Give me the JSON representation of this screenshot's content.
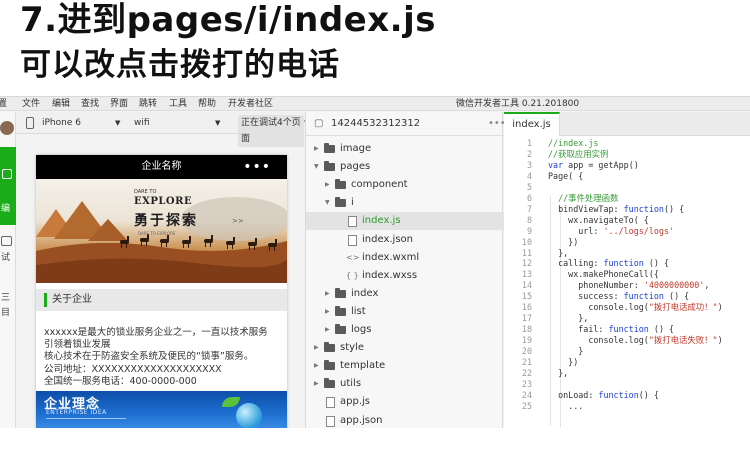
{
  "heading": {
    "line1": "7.进到pages/i/index.js",
    "line2": "可以改点击拨打的电话"
  },
  "menubar": {
    "items": [
      "置",
      "文件",
      "编辑",
      "查找",
      "界面",
      "跳转",
      "工具",
      "帮助",
      "开发者社区"
    ],
    "title": "微信开发者工具 0.21.201800"
  },
  "leftstrip": {
    "active_label": "编",
    "labels": [
      "试",
      "三",
      "目"
    ]
  },
  "device_toolbar": {
    "device": "iPhone 6",
    "network": "wifi",
    "debug_status": "正在调试4个页面"
  },
  "simulator": {
    "nav_title": "企业名称",
    "nav_menu": "•••",
    "banner": {
      "small_text": "DARE TO",
      "big_text": "EXPLORE",
      "cn_text": "勇于探索",
      "arrow": ">>",
      "sub_text": "DARE TO EXPLORE"
    },
    "about_label": "关于企业",
    "about_lines": [
      "xxxxxx是最大的锁业服务企业之一，一直以技术服务",
      "引领着锁业发展",
      "核心技术在于防盗安全系统及便民的“锁事”服务。",
      "公司地址：XXXXXXXXXXXXXXXXXXXX",
      "全国统一服务电话：400-0000-000"
    ],
    "idea_title": "企业理念",
    "idea_subtitle": "ENTERPRISE IDEA"
  },
  "filetree": {
    "project": "14244532312312",
    "more": "•••",
    "rows": [
      {
        "label": "image",
        "type": "folder",
        "open": false,
        "depth": 0
      },
      {
        "label": "pages",
        "type": "folder",
        "open": true,
        "depth": 0
      },
      {
        "label": "component",
        "type": "folder",
        "open": false,
        "depth": 1
      },
      {
        "label": "i",
        "type": "folder",
        "open": true,
        "depth": 1
      },
      {
        "label": "index.js",
        "type": "js",
        "depth": 2,
        "selected": true
      },
      {
        "label": "index.json",
        "type": "json",
        "depth": 2
      },
      {
        "label": "index.wxml",
        "type": "wxml",
        "depth": 2
      },
      {
        "label": "index.wxss",
        "type": "wxss",
        "depth": 2
      },
      {
        "label": "index",
        "type": "folder",
        "open": false,
        "depth": 1
      },
      {
        "label": "list",
        "type": "folder",
        "open": false,
        "depth": 1
      },
      {
        "label": "logs",
        "type": "folder",
        "open": false,
        "depth": 1
      },
      {
        "label": "style",
        "type": "folder",
        "open": false,
        "depth": 0
      },
      {
        "label": "template",
        "type": "folder",
        "open": false,
        "depth": 0
      },
      {
        "label": "utils",
        "type": "folder",
        "open": false,
        "depth": 0
      },
      {
        "label": "app.js",
        "type": "js",
        "depth": 0
      },
      {
        "label": "app.json",
        "type": "json",
        "depth": 0
      }
    ]
  },
  "editor": {
    "tab": "index.js",
    "lines": [
      [
        {
          "t": "//index.js",
          "c": "com"
        }
      ],
      [
        {
          "t": "//获取应用实例",
          "c": "com"
        }
      ],
      [
        {
          "t": "var",
          "c": "kw"
        },
        {
          "t": " app = getApp()"
        }
      ],
      [
        {
          "t": "Page( {"
        }
      ],
      [
        {
          "t": ""
        }
      ],
      [
        {
          "t": "  //事件处理函数",
          "c": "com"
        }
      ],
      [
        {
          "t": "  bindViewTap: "
        },
        {
          "t": "function",
          "c": "kw"
        },
        {
          "t": "() {"
        }
      ],
      [
        {
          "t": "    wx.navigateTo( {"
        }
      ],
      [
        {
          "t": "      url: "
        },
        {
          "t": "'../logs/logs'",
          "c": "str"
        }
      ],
      [
        {
          "t": "    })"
        }
      ],
      [
        {
          "t": "  },"
        }
      ],
      [
        {
          "t": "  calling: "
        },
        {
          "t": "function",
          "c": "kw"
        },
        {
          "t": " () {"
        }
      ],
      [
        {
          "t": "    wx.makePhoneCall({"
        }
      ],
      [
        {
          "t": "      phoneNumber: "
        },
        {
          "t": "'4000000000'",
          "c": "str"
        },
        {
          "t": ","
        }
      ],
      [
        {
          "t": "      success: "
        },
        {
          "t": "function",
          "c": "kw"
        },
        {
          "t": " () {"
        }
      ],
      [
        {
          "t": "        console.log("
        },
        {
          "t": "\"拨打电话成功！\"",
          "c": "str"
        },
        {
          "t": ")"
        }
      ],
      [
        {
          "t": "      },"
        }
      ],
      [
        {
          "t": "      fail: "
        },
        {
          "t": "function",
          "c": "kw"
        },
        {
          "t": " () {"
        }
      ],
      [
        {
          "t": "        console.log("
        },
        {
          "t": "\"拨打电话失败！\"",
          "c": "str"
        },
        {
          "t": ")"
        }
      ],
      [
        {
          "t": "      }"
        }
      ],
      [
        {
          "t": "    })"
        }
      ],
      [
        {
          "t": "  },"
        }
      ],
      [
        {
          "t": ""
        }
      ],
      [
        {
          "t": "  onLoad: "
        },
        {
          "t": "function",
          "c": "kw"
        },
        {
          "t": "() {"
        }
      ],
      [
        {
          "t": "    ..."
        }
      ]
    ]
  },
  "colors": {
    "accent_green": "#1aad19",
    "keyword_blue": "#1b3fd6",
    "comment_green": "#3a9a3a",
    "string_red": "#c0392b"
  }
}
